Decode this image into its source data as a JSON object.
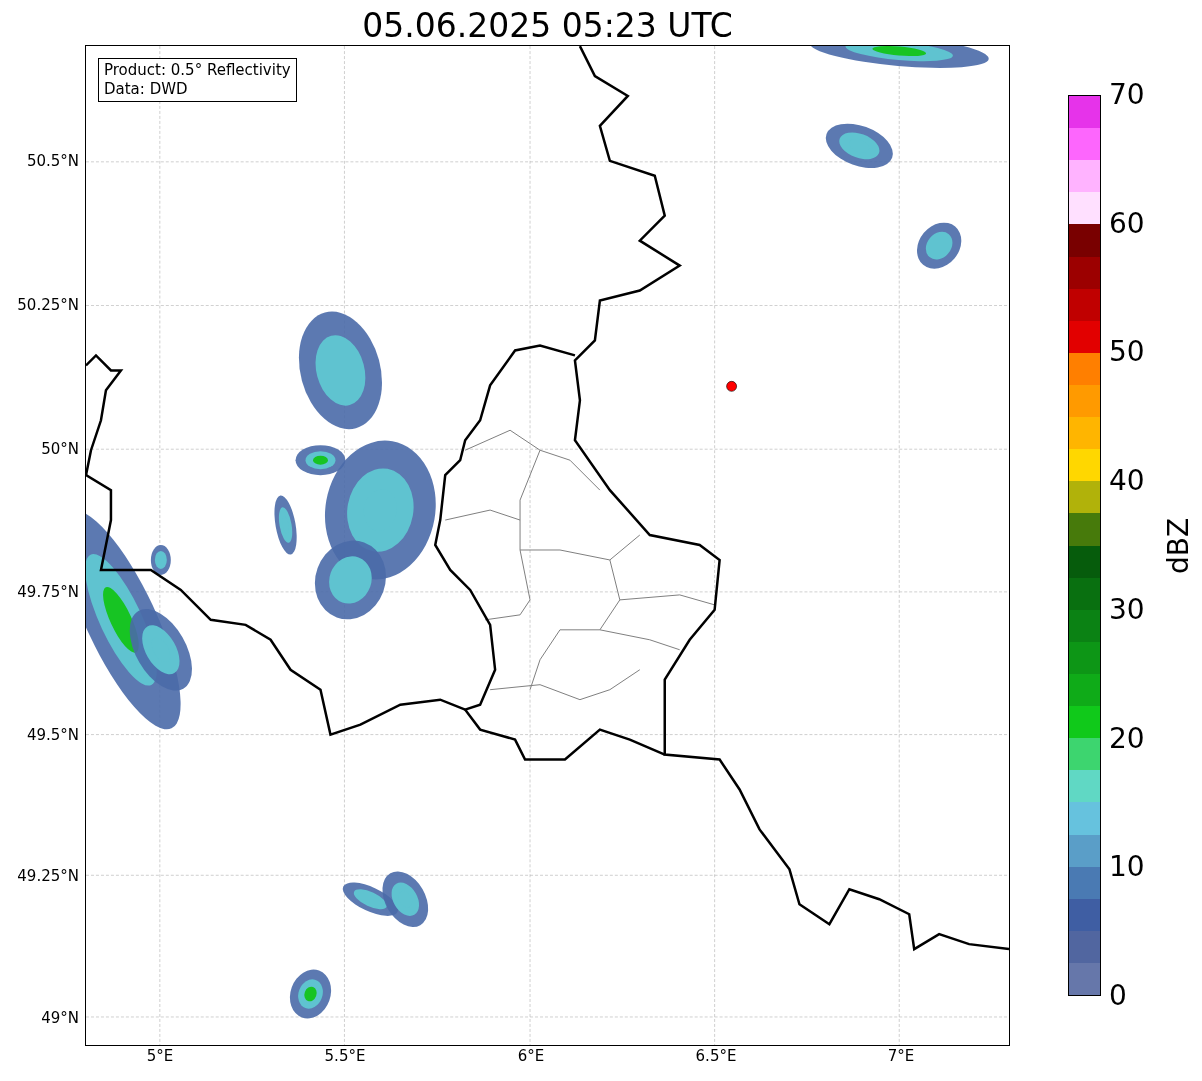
{
  "title": "05.06.2025 05:23 UTC",
  "info_box": [
    "Product: 0.5° Reflectivity",
    "Data: DWD"
  ],
  "x_ticks": [
    "5°E",
    "5.5°E",
    "6°E",
    "6.5°E",
    "7°E"
  ],
  "y_ticks": [
    "50.5°N",
    "50.25°N",
    "50°N",
    "49.75°N",
    "49.5°N",
    "49.25°N",
    "49°N"
  ],
  "colorbar": {
    "label": "dBZ",
    "ticks": [
      "70",
      "60",
      "50",
      "40",
      "30",
      "20",
      "10",
      "0"
    ],
    "bands": [
      {
        "color": "#e633ea"
      },
      {
        "color": "#fd66fd"
      },
      {
        "color": "#ffb3ff"
      },
      {
        "color": "#ffe0ff"
      },
      {
        "color": "#790000"
      },
      {
        "color": "#9c0000"
      },
      {
        "color": "#c00000"
      },
      {
        "color": "#e20000"
      },
      {
        "color": "#ff7f00"
      },
      {
        "color": "#ff9a00"
      },
      {
        "color": "#ffb500"
      },
      {
        "color": "#ffd700"
      },
      {
        "color": "#b1b20a"
      },
      {
        "color": "#477a0b"
      },
      {
        "color": "#065c0c"
      },
      {
        "color": "#097010"
      },
      {
        "color": "#0b8214"
      },
      {
        "color": "#0d9616"
      },
      {
        "color": "#0fab18"
      },
      {
        "color": "#10c91a"
      },
      {
        "color": "#3dd56f"
      },
      {
        "color": "#60d8c4"
      },
      {
        "color": "#66c2de"
      },
      {
        "color": "#5a9ec8"
      },
      {
        "color": "#4a7ab3"
      },
      {
        "color": "#3f5ea3"
      },
      {
        "color": "#5166a0"
      },
      {
        "color": "#6677aa"
      }
    ]
  }
}
